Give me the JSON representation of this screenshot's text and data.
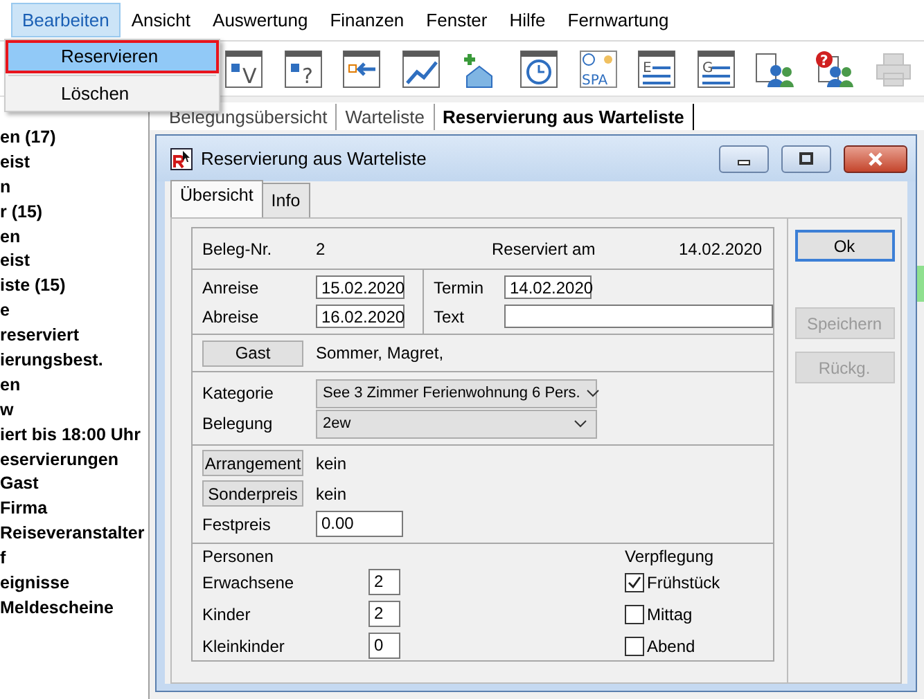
{
  "menubar": [
    {
      "label": "Bearbeiten",
      "selected": true
    },
    {
      "label": "Ansicht",
      "selected": false
    },
    {
      "label": "Auswertung",
      "selected": false
    },
    {
      "label": "Finanzen",
      "selected": false
    },
    {
      "label": "Fenster",
      "selected": false
    },
    {
      "label": "Hilfe",
      "selected": false
    },
    {
      "label": "Fernwartung",
      "selected": false
    }
  ],
  "menu_popup": [
    {
      "label": "Reservieren",
      "selected": true
    },
    {
      "label": "Löschen",
      "selected": false
    }
  ],
  "toolbar": [
    {
      "kind": "letter",
      "glyph": "V"
    },
    {
      "kind": "letter",
      "glyph": "?"
    },
    {
      "kind": "arrow"
    },
    {
      "kind": "chart"
    },
    {
      "kind": "house"
    },
    {
      "kind": "clock"
    },
    {
      "kind": "spa",
      "glyph": "SPA"
    },
    {
      "kind": "list",
      "glyph": "E"
    },
    {
      "kind": "list",
      "glyph": "G"
    },
    {
      "kind": "people"
    },
    {
      "kind": "people-alert",
      "glyph": "?"
    },
    {
      "kind": "printer",
      "disabled": true
    }
  ],
  "sidebar": {
    "items": [
      "en (17)",
      "eist",
      "n",
      "r (15)",
      "en",
      "eist",
      "iste (15)",
      "e",
      "reserviert",
      "ierungsbest.",
      "en",
      "w",
      "iert bis 18:00 Uhr",
      "eservierungen",
      "Gast",
      "Firma",
      "Reiseveranstalter",
      "f",
      "eignisse",
      "Meldescheine"
    ]
  },
  "doc_tabs": [
    {
      "label": "Belegungsübersicht",
      "selected": false
    },
    {
      "label": "Warteliste",
      "selected": false
    },
    {
      "label": "Reservierung aus Warteliste",
      "selected": true
    }
  ],
  "dialog": {
    "title": "Reservierung aus Warteliste",
    "tabs": [
      {
        "label": "Übersicht",
        "selected": true
      },
      {
        "label": "Info",
        "selected": false
      }
    ],
    "beleg": {
      "label": "Beleg-Nr.",
      "value": "2",
      "reserved_label": "Reserviert am",
      "reserved_value": "14.02.2020"
    },
    "dates": [
      {
        "label": "Anreise",
        "value": "15.02.2020",
        "side_label": "Termin",
        "side_field": {
          "kind": "date",
          "value": "14.02.2020"
        }
      },
      {
        "label": "Abreise",
        "value": "16.02.2020",
        "side_label": "Text",
        "side_field": {
          "kind": "text"
        }
      }
    ],
    "guest": {
      "button": "Gast",
      "value": "Sommer, Magret,"
    },
    "selects": [
      {
        "label": "Kategorie",
        "value": "See 3 Zimmer Ferienwohnung 6 Pers."
      },
      {
        "label": "Belegung",
        "value": "2ew"
      }
    ],
    "extras": [
      {
        "button": "Arrangement",
        "value": "kein"
      },
      {
        "button": "Sonderpreis",
        "value": "kein"
      }
    ],
    "fixed_price": {
      "label": "Festpreis",
      "value": "0.00"
    },
    "persons": {
      "title": "Personen",
      "rows": [
        {
          "label": "Erwachsene",
          "value": "2"
        },
        {
          "label": "Kinder",
          "value": "2"
        },
        {
          "label": "Kleinkinder",
          "value": "0"
        }
      ]
    },
    "meals": {
      "title": "Verpflegung",
      "items": [
        {
          "label": "Frühstück",
          "checked": true
        },
        {
          "label": "Mittag",
          "checked": false
        },
        {
          "label": "Abend",
          "checked": false
        }
      ]
    },
    "buttons": [
      {
        "label": "Ok",
        "disabled": false
      },
      {
        "label": "Speichern",
        "disabled": true
      },
      {
        "label": "Rückg.",
        "disabled": true
      }
    ]
  }
}
